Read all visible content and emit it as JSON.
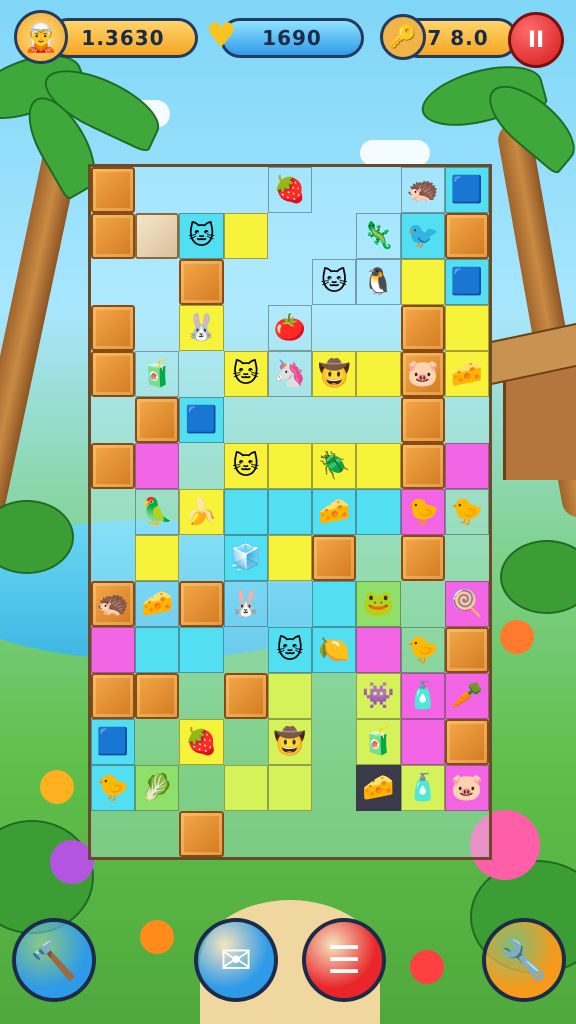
{
  "hud": {
    "score": "1.3630",
    "gems": "1690",
    "coins": "7 8.0",
    "menu_label": "II"
  },
  "colors": {
    "crate": "#e8902f",
    "yellow": "#f7f23a",
    "pink": "#f266e6",
    "cyan": "#52dff2",
    "lime": "#d6f25a",
    "menu_red": "#d41a1a",
    "hud_blue": "#2f9be8",
    "hud_orange": "#f5a623"
  },
  "board": {
    "cols": 9,
    "rows": 15,
    "tiles": [
      {
        "r": 0,
        "c": 0,
        "k": "crate"
      },
      {
        "r": 0,
        "c": 4,
        "k": "empty",
        "g": "🍓"
      },
      {
        "r": 0,
        "c": 8,
        "k": "cyan",
        "g": "🟦"
      },
      {
        "r": 0,
        "c": 7,
        "k": "empty",
        "g": "🦔"
      },
      {
        "r": 1,
        "c": 0,
        "k": "crate"
      },
      {
        "r": 1,
        "c": 1,
        "k": "beige"
      },
      {
        "r": 1,
        "c": 2,
        "k": "cyan",
        "g": "🐱"
      },
      {
        "r": 1,
        "c": 3,
        "k": "yellow"
      },
      {
        "r": 1,
        "c": 6,
        "k": "empty",
        "g": "🦎"
      },
      {
        "r": 1,
        "c": 7,
        "k": "cyan",
        "g": "🐦"
      },
      {
        "r": 1,
        "c": 8,
        "k": "crate"
      },
      {
        "r": 2,
        "c": 2,
        "k": "crate"
      },
      {
        "r": 2,
        "c": 5,
        "k": "empty",
        "g": "🐱"
      },
      {
        "r": 2,
        "c": 6,
        "k": "empty",
        "g": "🐧"
      },
      {
        "r": 2,
        "c": 7,
        "k": "yellow"
      },
      {
        "r": 2,
        "c": 8,
        "k": "cyan",
        "g": "🟦"
      },
      {
        "r": 3,
        "c": 0,
        "k": "crate"
      },
      {
        "r": 3,
        "c": 2,
        "k": "yellow",
        "g": "🐰"
      },
      {
        "r": 3,
        "c": 4,
        "k": "empty",
        "g": "🍅"
      },
      {
        "r": 3,
        "c": 7,
        "k": "crate"
      },
      {
        "r": 3,
        "c": 8,
        "k": "yellow"
      },
      {
        "r": 4,
        "c": 0,
        "k": "crate"
      },
      {
        "r": 4,
        "c": 1,
        "k": "empty",
        "g": "🧃"
      },
      {
        "r": 4,
        "c": 3,
        "k": "yellow",
        "g": "🐱"
      },
      {
        "r": 4,
        "c": 4,
        "k": "empty",
        "g": "🦄"
      },
      {
        "r": 4,
        "c": 5,
        "k": "yellow",
        "g": "🤠"
      },
      {
        "r": 4,
        "c": 6,
        "k": "yellow"
      },
      {
        "r": 4,
        "c": 7,
        "k": "crate",
        "g": "🐷"
      },
      {
        "r": 4,
        "c": 8,
        "k": "yellow",
        "g": "🧀"
      },
      {
        "r": 5,
        "c": 1,
        "k": "crate"
      },
      {
        "r": 5,
        "c": 2,
        "k": "cyan",
        "g": "🟦"
      },
      {
        "r": 5,
        "c": 7,
        "k": "crate"
      },
      {
        "r": 6,
        "c": 0,
        "k": "crate"
      },
      {
        "r": 6,
        "c": 1,
        "k": "pink"
      },
      {
        "r": 6,
        "c": 3,
        "k": "yellow",
        "g": "🐱"
      },
      {
        "r": 6,
        "c": 4,
        "k": "yellow"
      },
      {
        "r": 6,
        "c": 5,
        "k": "yellow",
        "g": "🪲"
      },
      {
        "r": 6,
        "c": 6,
        "k": "yellow"
      },
      {
        "r": 6,
        "c": 7,
        "k": "crate"
      },
      {
        "r": 6,
        "c": 8,
        "k": "pink"
      },
      {
        "r": 7,
        "c": 1,
        "k": "empty",
        "g": "🦜"
      },
      {
        "r": 7,
        "c": 2,
        "k": "yellow",
        "g": "🍌"
      },
      {
        "r": 7,
        "c": 3,
        "k": "cyan"
      },
      {
        "r": 7,
        "c": 4,
        "k": "cyan"
      },
      {
        "r": 7,
        "c": 5,
        "k": "cyan",
        "g": "🧀"
      },
      {
        "r": 7,
        "c": 6,
        "k": "cyan"
      },
      {
        "r": 7,
        "c": 7,
        "k": "pink",
        "g": "🐤"
      },
      {
        "r": 7,
        "c": 8,
        "k": "empty",
        "g": "🐤"
      },
      {
        "r": 8,
        "c": 1,
        "k": "yellow"
      },
      {
        "r": 8,
        "c": 3,
        "k": "cyan",
        "g": "🧊"
      },
      {
        "r": 8,
        "c": 4,
        "k": "yellow"
      },
      {
        "r": 8,
        "c": 5,
        "k": "crate"
      },
      {
        "r": 8,
        "c": 7,
        "k": "crate"
      },
      {
        "r": 9,
        "c": 0,
        "k": "crate",
        "g": "🦔"
      },
      {
        "r": 9,
        "c": 1,
        "k": "empty",
        "g": "🧀"
      },
      {
        "r": 9,
        "c": 2,
        "k": "crate"
      },
      {
        "r": 9,
        "c": 3,
        "k": "empty",
        "g": "🐰"
      },
      {
        "r": 9,
        "c": 5,
        "k": "cyan"
      },
      {
        "r": 9,
        "c": 6,
        "k": "green",
        "g": "🐸"
      },
      {
        "r": 9,
        "c": 8,
        "k": "pink",
        "g": "🍭"
      },
      {
        "r": 10,
        "c": 0,
        "k": "pink"
      },
      {
        "r": 10,
        "c": 1,
        "k": "cyan"
      },
      {
        "r": 10,
        "c": 2,
        "k": "cyan"
      },
      {
        "r": 10,
        "c": 4,
        "k": "cyan",
        "g": "🐱"
      },
      {
        "r": 10,
        "c": 5,
        "k": "cyan",
        "g": "🍋"
      },
      {
        "r": 10,
        "c": 6,
        "k": "pink"
      },
      {
        "r": 10,
        "c": 7,
        "k": "empty",
        "g": "🐤"
      },
      {
        "r": 10,
        "c": 8,
        "k": "crate"
      },
      {
        "r": 11,
        "c": 0,
        "k": "crate"
      },
      {
        "r": 11,
        "c": 1,
        "k": "crate"
      },
      {
        "r": 11,
        "c": 3,
        "k": "crate"
      },
      {
        "r": 11,
        "c": 4,
        "k": "lime"
      },
      {
        "r": 11,
        "c": 6,
        "k": "lime",
        "g": "👾"
      },
      {
        "r": 11,
        "c": 7,
        "k": "pink",
        "g": "🧴"
      },
      {
        "r": 11,
        "c": 8,
        "k": "pink",
        "g": "🥕"
      },
      {
        "r": 12,
        "c": 0,
        "k": "cyan",
        "g": "🟦"
      },
      {
        "r": 12,
        "c": 2,
        "k": "yellow",
        "g": "🍓"
      },
      {
        "r": 12,
        "c": 4,
        "k": "lime",
        "g": "🤠"
      },
      {
        "r": 12,
        "c": 6,
        "k": "lime",
        "g": "🧃"
      },
      {
        "r": 12,
        "c": 7,
        "k": "pink"
      },
      {
        "r": 12,
        "c": 8,
        "k": "crate"
      },
      {
        "r": 13,
        "c": 0,
        "k": "cyan",
        "g": "🐤"
      },
      {
        "r": 13,
        "c": 1,
        "k": "green",
        "g": "🥬"
      },
      {
        "r": 13,
        "c": 3,
        "k": "lime"
      },
      {
        "r": 13,
        "c": 4,
        "k": "lime"
      },
      {
        "r": 13,
        "c": 6,
        "k": "dark",
        "g": "🧀"
      },
      {
        "r": 13,
        "c": 7,
        "k": "lime",
        "g": "🧴"
      },
      {
        "r": 13,
        "c": 8,
        "k": "pink",
        "g": "🐷"
      },
      {
        "r": 14,
        "c": 2,
        "k": "crate"
      }
    ]
  },
  "buttons": [
    {
      "name": "hammer-button",
      "icon": "🔨",
      "color": "#2f9be8"
    },
    {
      "name": "mail-button",
      "icon": "✉",
      "color": "#2f9be8"
    },
    {
      "name": "list-button",
      "icon": "☰",
      "color": "#e8262a"
    },
    {
      "name": "tools-button",
      "icon": "🔧",
      "color": "#f59a1a"
    }
  ]
}
